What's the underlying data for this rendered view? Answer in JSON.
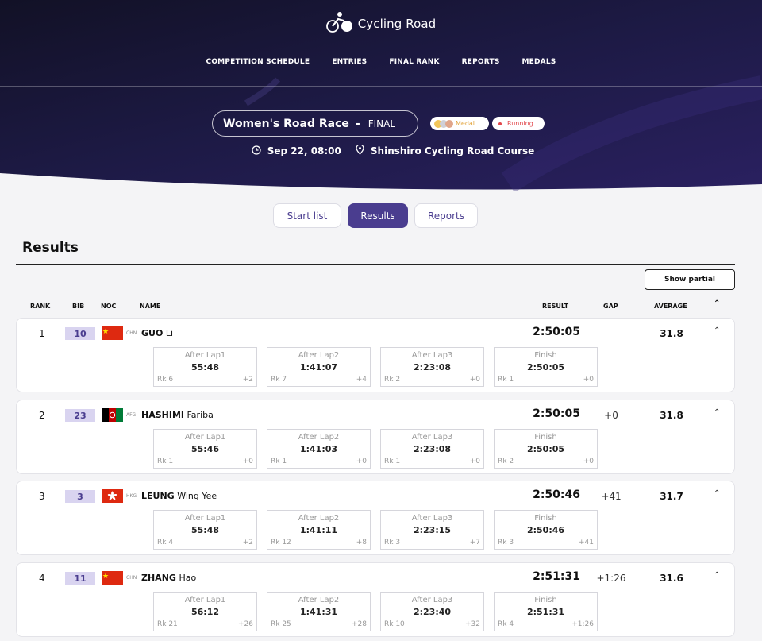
{
  "app": {
    "title": "Cycling Road"
  },
  "nav": [
    "COMPETITION SCHEDULE",
    "ENTRIES",
    "FINAL RANK",
    "REPORTS",
    "MEDALS"
  ],
  "event": {
    "name": "Women's Road Race",
    "dash": "-",
    "phase": "FINAL",
    "medal_badge": "Medal",
    "status_badge": "Running",
    "datetime": "Sep 22, 08:00",
    "venue": "Shinshiro Cycling Road Course"
  },
  "colors": {
    "header_bg": "#1b1840",
    "accent": "#4a3d8f",
    "bib_bg": "#d9d4f0",
    "medal": "#e2a43d",
    "running": "#e2474b"
  },
  "tabs": [
    {
      "label": "Start list",
      "active": false
    },
    {
      "label": "Results",
      "active": true
    },
    {
      "label": "Reports",
      "active": false
    }
  ],
  "section_title": "Results",
  "show_partial": "Show partial",
  "columns": {
    "rank": "RANK",
    "bib": "BIB",
    "noc": "NOC",
    "name": "NAME",
    "result": "RESULT",
    "gap": "GAP",
    "average": "AVERAGE"
  },
  "rows": [
    {
      "rank": "1",
      "bib": "10",
      "noc": "CHN",
      "surname": "GUO",
      "given": "Li",
      "result": "2:50:05",
      "gap": "",
      "average": "31.8",
      "splits": [
        {
          "label": "After Lap1",
          "time": "55:48",
          "rk": "Rk 6",
          "gap": "+2"
        },
        {
          "label": "After Lap2",
          "time": "1:41:07",
          "rk": "Rk 7",
          "gap": "+4"
        },
        {
          "label": "After Lap3",
          "time": "2:23:08",
          "rk": "Rk 2",
          "gap": "+0"
        },
        {
          "label": "Finish",
          "time": "2:50:05",
          "rk": "Rk 1",
          "gap": "+0"
        }
      ]
    },
    {
      "rank": "2",
      "bib": "23",
      "noc": "AFG",
      "surname": "HASHIMI",
      "given": "Fariba",
      "result": "2:50:05",
      "gap": "+0",
      "average": "31.8",
      "splits": [
        {
          "label": "After Lap1",
          "time": "55:46",
          "rk": "Rk 1",
          "gap": "+0"
        },
        {
          "label": "After Lap2",
          "time": "1:41:03",
          "rk": "Rk 1",
          "gap": "+0"
        },
        {
          "label": "After Lap3",
          "time": "2:23:08",
          "rk": "Rk 1",
          "gap": "+0"
        },
        {
          "label": "Finish",
          "time": "2:50:05",
          "rk": "Rk 2",
          "gap": "+0"
        }
      ]
    },
    {
      "rank": "3",
      "bib": "3",
      "noc": "HKG",
      "surname": "LEUNG",
      "given": "Wing Yee",
      "result": "2:50:46",
      "gap": "+41",
      "average": "31.7",
      "splits": [
        {
          "label": "After Lap1",
          "time": "55:48",
          "rk": "Rk 4",
          "gap": "+2"
        },
        {
          "label": "After Lap2",
          "time": "1:41:11",
          "rk": "Rk 12",
          "gap": "+8"
        },
        {
          "label": "After Lap3",
          "time": "2:23:15",
          "rk": "Rk 3",
          "gap": "+7"
        },
        {
          "label": "Finish",
          "time": "2:50:46",
          "rk": "Rk 3",
          "gap": "+41"
        }
      ]
    },
    {
      "rank": "4",
      "bib": "11",
      "noc": "CHN",
      "surname": "ZHANG",
      "given": "Hao",
      "result": "2:51:31",
      "gap": "+1:26",
      "average": "31.6",
      "splits": [
        {
          "label": "After Lap1",
          "time": "56:12",
          "rk": "Rk 21",
          "gap": "+26"
        },
        {
          "label": "After Lap2",
          "time": "1:41:31",
          "rk": "Rk 25",
          "gap": "+28"
        },
        {
          "label": "After Lap3",
          "time": "2:23:40",
          "rk": "Rk 10",
          "gap": "+32"
        },
        {
          "label": "Finish",
          "time": "2:51:31",
          "rk": "Rk 4",
          "gap": "+1:26"
        }
      ]
    }
  ]
}
